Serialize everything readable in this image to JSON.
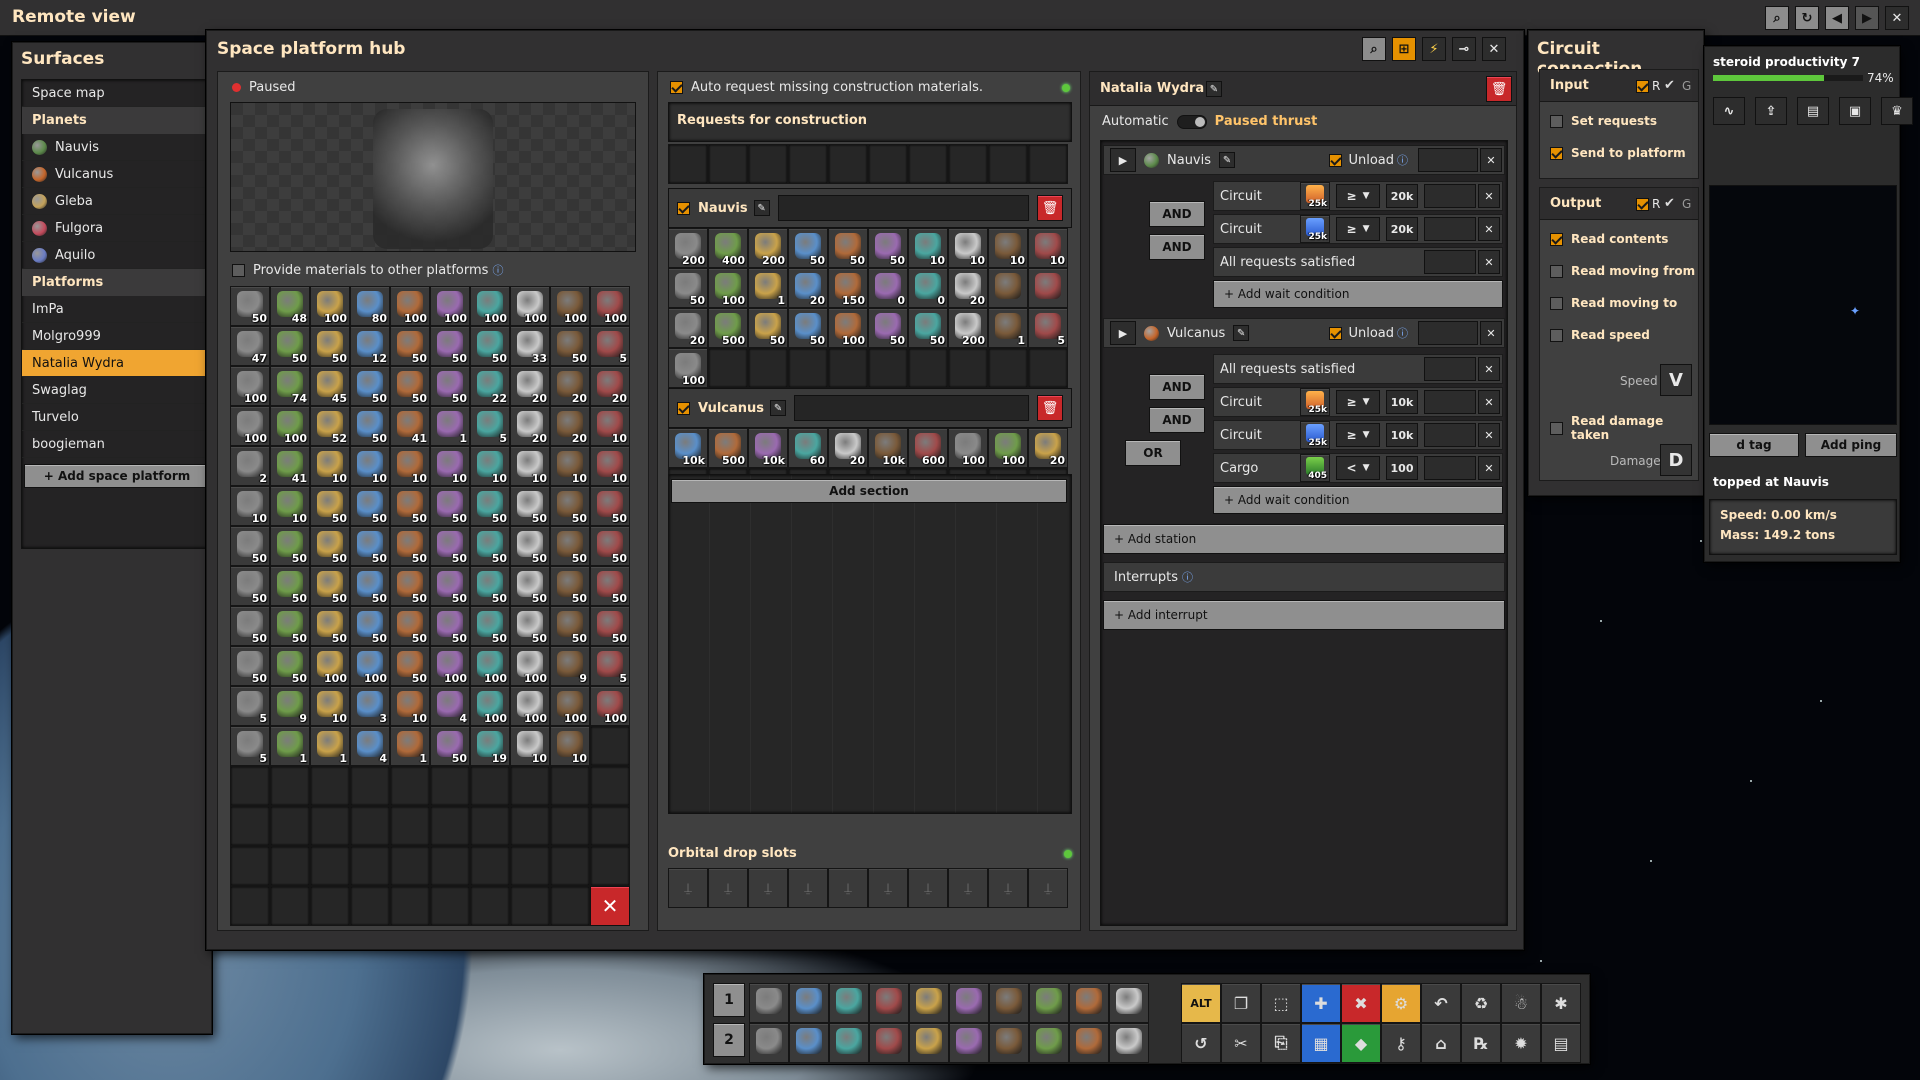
{
  "window_title": "Remote view",
  "surfaces": {
    "title": "Surfaces",
    "space_map": "Space map",
    "planets_header": "Planets",
    "planets": [
      {
        "label": "Nauvis",
        "color": "#5c8a4a"
      },
      {
        "label": "Vulcanus",
        "color": "#c5652a"
      },
      {
        "label": "Gleba",
        "color": "#c4a25a"
      },
      {
        "label": "Fulgora",
        "color": "#c44a5c"
      },
      {
        "label": "Aquilo",
        "color": "#6a7cc4"
      }
    ],
    "platforms_header": "Platforms",
    "platforms": [
      "ImPa",
      "Molgro999",
      "Natalia Wydra",
      "Swaglag",
      "Turvelo",
      "boogieman"
    ],
    "selected_platform": "Natalia Wydra",
    "add_platform": "+ Add space platform"
  },
  "hub": {
    "title": "Space platform hub",
    "status": "Paused",
    "provide_label": "Provide materials to other platforms",
    "inventory_counts": [
      "50",
      "48",
      "100",
      "80",
      "100",
      "100",
      "100",
      "100",
      "100",
      "100",
      "47",
      "50",
      "50",
      "12",
      "50",
      "50",
      "50",
      "33",
      "50",
      "5",
      "100",
      "74",
      "45",
      "50",
      "50",
      "50",
      "22",
      "20",
      "20",
      "20",
      "100",
      "100",
      "52",
      "50",
      "41",
      "1",
      "5",
      "20",
      "20",
      "10",
      "2",
      "41",
      "10",
      "10",
      "10",
      "10",
      "10",
      "10",
      "10",
      "10",
      "10",
      "10",
      "50",
      "50",
      "50",
      "50",
      "50",
      "50",
      "50",
      "50",
      "50",
      "50",
      "50",
      "50",
      "50",
      "50",
      "50",
      "50",
      "50",
      "50",
      "50",
      "50",
      "50",
      "50",
      "50",
      "50",
      "50",
      "50",
      "50",
      "50",
      "50",
      "50",
      "50",
      "50",
      "50",
      "50",
      "50",
      "50",
      "50",
      "50",
      "50",
      "50",
      "100",
      "100",
      "50",
      "100",
      "100",
      "100",
      "9",
      "5",
      "5",
      "9",
      "10",
      "3",
      "10",
      "4",
      "100",
      "100",
      "100",
      "100",
      "5",
      "1",
      "1",
      "4",
      "1",
      "50",
      "19",
      "10",
      "10"
    ],
    "trash_label": "✕"
  },
  "requests": {
    "auto_label": "Auto request missing construction materials.",
    "construction_title": "Requests for construction",
    "sections": [
      {
        "name": "Nauvis",
        "counts": [
          "200",
          "400",
          "200",
          "50",
          "50",
          "50",
          "10",
          "10",
          "10",
          "10",
          "50",
          "100",
          "1",
          "20",
          "150",
          "0",
          "0",
          "20",
          "",
          "",
          "20",
          "500",
          "50",
          "50",
          "100",
          "50",
          "50",
          "200",
          "1",
          "5",
          "100"
        ]
      },
      {
        "name": "Vulcanus",
        "counts": [
          "10k",
          "500",
          "10k",
          "60",
          "20",
          "10k",
          "600",
          "100",
          "100",
          "20"
        ]
      }
    ],
    "add_section": "Add section",
    "orbital_title": "Orbital drop slots"
  },
  "schedule": {
    "platform_name": "Natalia Wydra",
    "automatic_label": "Automatic",
    "paused_thrust": "Paused thrust",
    "stations": [
      {
        "name": "Nauvis",
        "unload": "Unload",
        "conditions": [
          {
            "type": "Circuit",
            "signal_count": "25k",
            "op": "≥",
            "value": "20k"
          },
          {
            "type": "Circuit",
            "signal_count": "25k",
            "op": "≥",
            "value": "20k"
          },
          {
            "type": "All requests satisfied"
          }
        ],
        "joins": [
          "AND",
          "AND"
        ]
      },
      {
        "name": "Vulcanus",
        "unload": "Unload",
        "conditions": [
          {
            "type": "All requests satisfied"
          },
          {
            "type": "Circuit",
            "signal_count": "25k",
            "op": "≥",
            "value": "10k"
          },
          {
            "type": "Circuit",
            "signal_count": "25k",
            "op": "≥",
            "value": "10k"
          },
          {
            "type": "Cargo",
            "signal_count": "405",
            "op": "<",
            "value": "100"
          }
        ],
        "joins": [
          "AND",
          "AND",
          "OR"
        ]
      }
    ],
    "add_wait": "+ Add wait condition",
    "add_station": "+ Add station",
    "interrupts": "Interrupts",
    "add_interrupt": "+ Add interrupt"
  },
  "circuit": {
    "title": "Circuit connection",
    "input": "Input",
    "output": "Output",
    "r": "R",
    "g": "G",
    "set_requests": "Set requests",
    "send_to_platform": "Send to platform",
    "read_contents": "Read contents",
    "read_moving_from": "Read moving from",
    "read_moving_to": "Read moving to",
    "read_speed": "Read speed",
    "speed_label": "Speed",
    "speed_signal": "V",
    "read_damage": "Read damage taken",
    "damage_label": "Damage",
    "damage_signal": "D"
  },
  "right_panel": {
    "research": "steroid productivity 7",
    "research_pct": "74%",
    "research_progress": 0.74,
    "add_tag": "d tag",
    "add_ping": "Add ping",
    "status": "topped at Nauvis",
    "speed": "Speed: 0.00 km/s",
    "mass": "Mass: 149.2 tons"
  },
  "quickbar": {
    "rows": [
      "1",
      "2"
    ],
    "alt": "ALT"
  }
}
